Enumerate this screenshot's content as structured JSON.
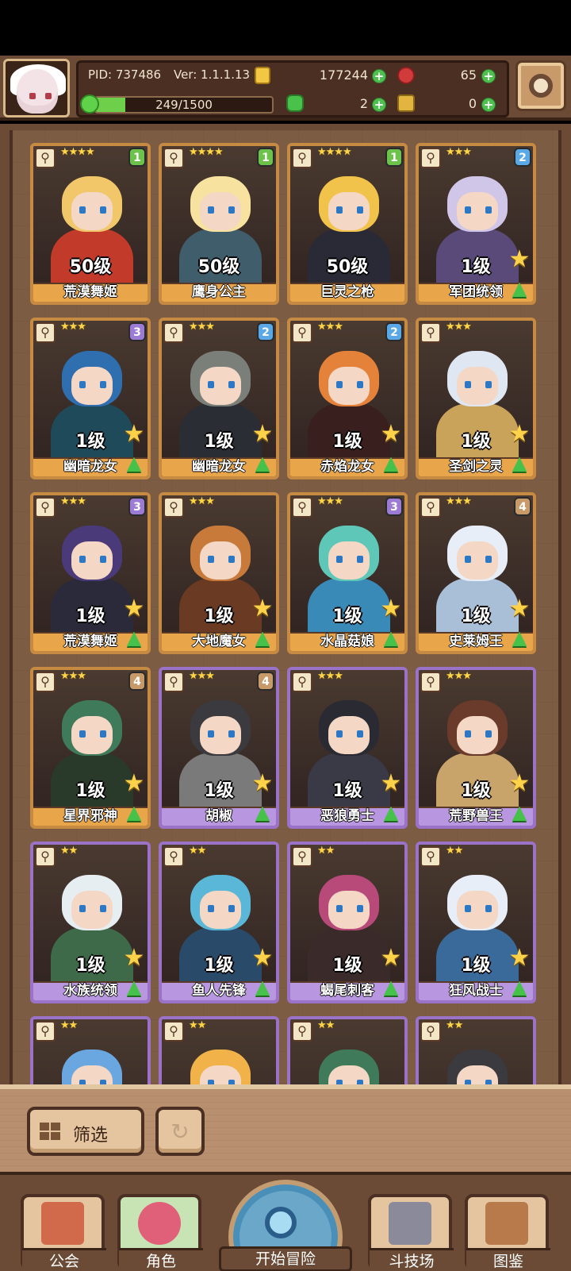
{
  "header": {
    "pid": "PID: 737486",
    "version": "Ver: 1.1.1.13",
    "gold": "177244",
    "gems": "65",
    "energy": "249/1500",
    "energy_fraction": 0.166,
    "clovers": "2",
    "keys": "0"
  },
  "colors": {
    "gold_border": "#c68a42",
    "purple_border": "#9a72c8",
    "accent_green": "#46c24a"
  },
  "cards": [
    {
      "name": "荒漠舞姬",
      "level": "50级",
      "stars": "★★★★",
      "tier": "1",
      "frame": "gold",
      "badges": false,
      "art": [
        "#f2c76a",
        "#c23a2a"
      ]
    },
    {
      "name": "鹰身公主",
      "level": "50级",
      "stars": "★★★★",
      "tier": "1",
      "frame": "gold",
      "badges": false,
      "art": [
        "#f7e2a0",
        "#3f5d6a"
      ]
    },
    {
      "name": "巨灵之枪",
      "level": "50级",
      "stars": "★★★★",
      "tier": "1",
      "frame": "gold",
      "badges": false,
      "art": [
        "#f2c34a",
        "#2a2a36"
      ]
    },
    {
      "name": "军团统领",
      "level": "1级",
      "stars": "★★★",
      "tier": "2",
      "frame": "gold",
      "badges": true,
      "art": [
        "#cfc6e8",
        "#5a4a7a"
      ]
    },
    {
      "name": "幽暗龙女",
      "level": "1级",
      "stars": "★★★",
      "tier": "3",
      "frame": "gold",
      "badges": true,
      "art": [
        "#2f6fb0",
        "#1f4a5a"
      ]
    },
    {
      "name": "幽暗龙女",
      "level": "1级",
      "stars": "★★★",
      "tier": "2",
      "frame": "gold",
      "badges": true,
      "art": [
        "#7a7f7a",
        "#2a2d33"
      ]
    },
    {
      "name": "赤焰龙女",
      "level": "1级",
      "stars": "★★★",
      "tier": "2",
      "frame": "gold",
      "badges": true,
      "art": [
        "#e5823a",
        "#3a1f1f"
      ]
    },
    {
      "name": "圣剑之灵",
      "level": "1级",
      "stars": "★★★",
      "tier": "",
      "frame": "gold",
      "badges": true,
      "art": [
        "#dfe7f2",
        "#c9a35a"
      ]
    },
    {
      "name": "荒漠舞姬",
      "level": "1级",
      "stars": "★★★",
      "tier": "3",
      "frame": "gold",
      "badges": true,
      "art": [
        "#4a3a7a",
        "#2a2a3a"
      ]
    },
    {
      "name": "大地魔女",
      "level": "1级",
      "stars": "★★★",
      "tier": "",
      "frame": "gold",
      "badges": true,
      "art": [
        "#c87a3a",
        "#6a3a22"
      ]
    },
    {
      "name": "水晶菇娘",
      "level": "1级",
      "stars": "★★★",
      "tier": "3",
      "frame": "gold",
      "badges": true,
      "art": [
        "#5fc7b7",
        "#3a8ab8"
      ]
    },
    {
      "name": "史莱姆王",
      "level": "1级",
      "stars": "★★★",
      "tier": "4",
      "frame": "gold",
      "badges": true,
      "art": [
        "#e7eef8",
        "#a9bfd8"
      ]
    },
    {
      "name": "星界邪神",
      "level": "1级",
      "stars": "★★★",
      "tier": "4",
      "frame": "gold",
      "badges": true,
      "art": [
        "#3f7a5a",
        "#2a3a2a"
      ]
    },
    {
      "name": "胡椒",
      "level": "1级",
      "stars": "★★★",
      "tier": "4",
      "frame": "purple",
      "badges": true,
      "art": [
        "#3a3a3f",
        "#7a7a7a"
      ]
    },
    {
      "name": "恶狼勇士",
      "level": "1级",
      "stars": "★★★",
      "tier": "",
      "frame": "purple",
      "badges": true,
      "art": [
        "#2a2a33",
        "#3a3a46"
      ]
    },
    {
      "name": "荒野兽王",
      "level": "1级",
      "stars": "★★★",
      "tier": "",
      "frame": "purple",
      "badges": true,
      "art": [
        "#6a3a2a",
        "#c8a36a"
      ]
    },
    {
      "name": "水族统领",
      "level": "1级",
      "stars": "★★",
      "tier": "",
      "frame": "purple",
      "badges": true,
      "art": [
        "#e7eef2",
        "#3f6a4a"
      ]
    },
    {
      "name": "鱼人先锋",
      "level": "1级",
      "stars": "★★",
      "tier": "",
      "frame": "purple",
      "badges": true,
      "art": [
        "#5ab7d8",
        "#2a4a6a"
      ]
    },
    {
      "name": "蝎尾刺客",
      "level": "1级",
      "stars": "★★",
      "tier": "",
      "frame": "purple",
      "badges": true,
      "art": [
        "#b84a7a",
        "#3a2a2a"
      ]
    },
    {
      "name": "狂风战士",
      "level": "1级",
      "stars": "★★",
      "tier": "",
      "frame": "purple",
      "badges": true,
      "art": [
        "#e7eef8",
        "#3a6a9a"
      ]
    },
    {
      "name": "",
      "level": "",
      "stars": "★★",
      "tier": "",
      "frame": "purple",
      "badges": false,
      "art": [
        "#6aa7e0",
        "#3a5a8a"
      ]
    },
    {
      "name": "",
      "level": "",
      "stars": "★★",
      "tier": "",
      "frame": "purple",
      "badges": false,
      "art": [
        "#f2b24a",
        "#6a3a22"
      ]
    },
    {
      "name": "",
      "level": "",
      "stars": "★★",
      "tier": "",
      "frame": "purple",
      "badges": false,
      "art": [
        "#3f7a5a",
        "#2a3a2a"
      ]
    },
    {
      "name": "",
      "level": "",
      "stars": "★★",
      "tier": "",
      "frame": "purple",
      "badges": false,
      "art": [
        "#3a3a3f",
        "#c87a6a"
      ]
    }
  ],
  "filter": {
    "label": "筛选"
  },
  "nav": {
    "guild": "公会",
    "character": "角色",
    "adventure": "开始冒险",
    "arena": "斗技场",
    "codex": "图鉴"
  }
}
